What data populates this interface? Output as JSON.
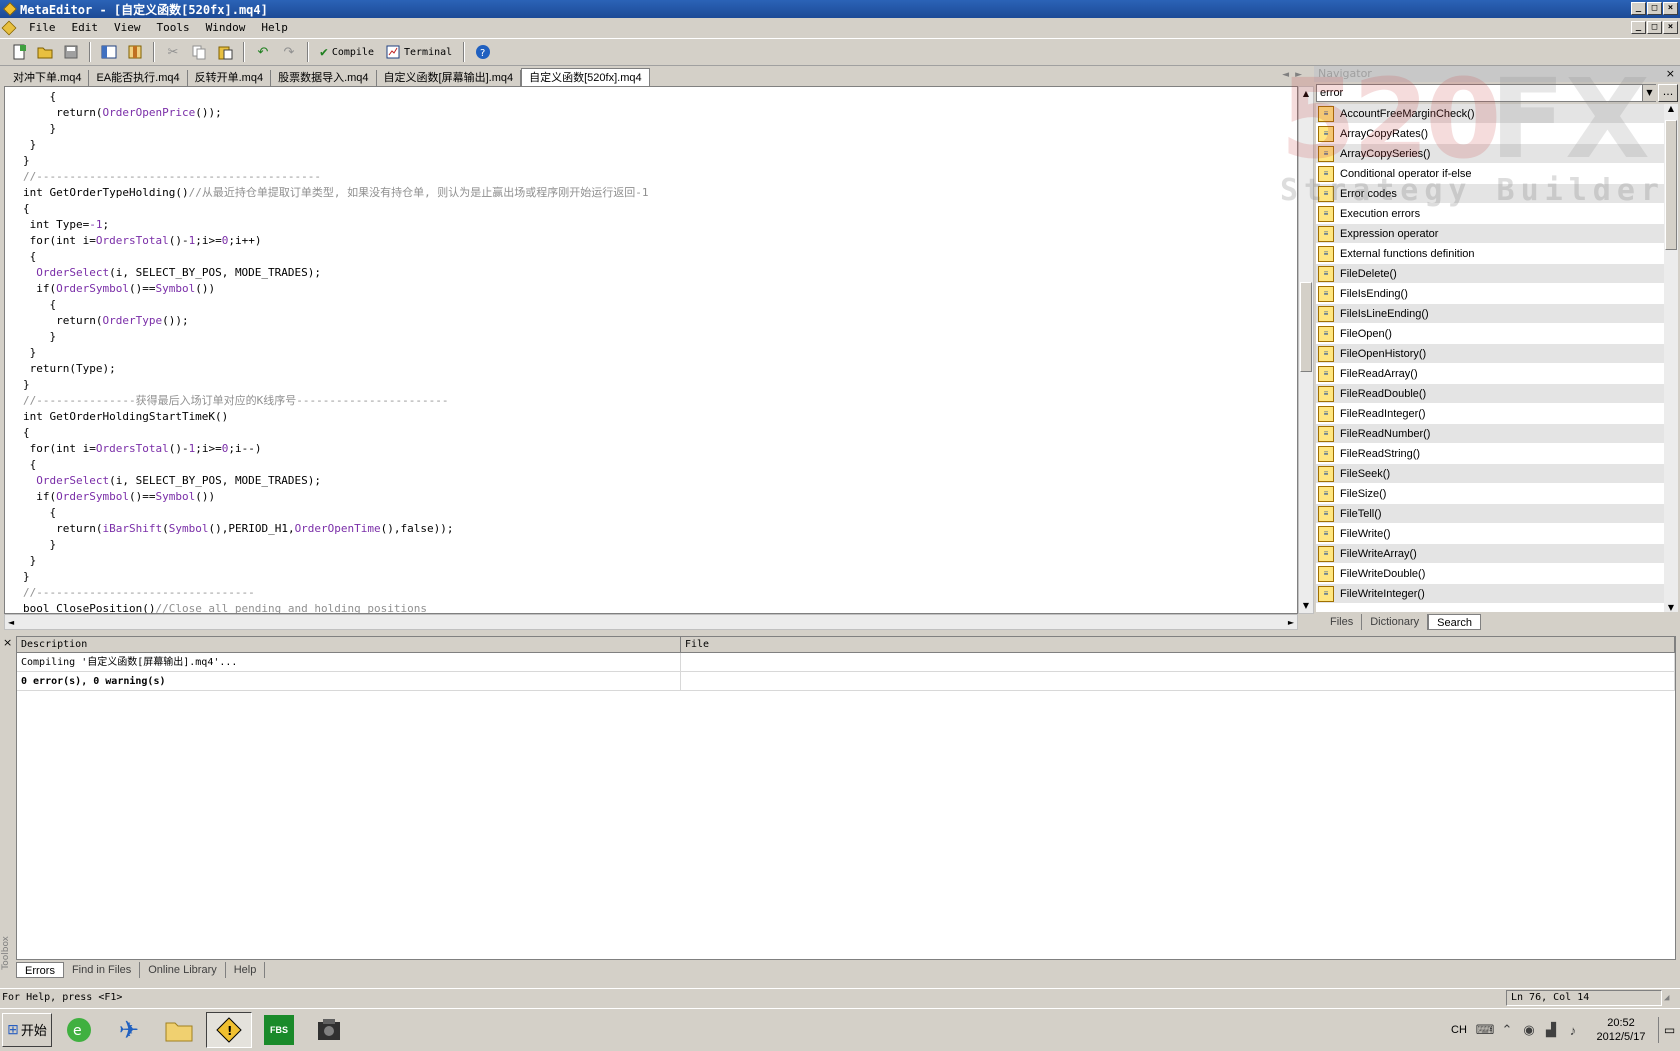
{
  "window": {
    "title": "MetaEditor - [自定义函数[520fx].mq4]",
    "min": "_",
    "max": "□",
    "close": "×"
  },
  "menu": {
    "items": [
      "File",
      "Edit",
      "View",
      "Tools",
      "Window",
      "Help"
    ]
  },
  "toolbar": {
    "compile_label": "Compile",
    "terminal_label": "Terminal"
  },
  "file_tabs": [
    {
      "label": "对冲下单.mq4",
      "active": false
    },
    {
      "label": "EA能否执行.mq4",
      "active": false
    },
    {
      "label": "反转开单.mq4",
      "active": false
    },
    {
      "label": "股票数据导入.mq4",
      "active": false
    },
    {
      "label": "自定义函数[屏幕输出].mq4",
      "active": false
    },
    {
      "label": "自定义函数[520fx].mq4",
      "active": true
    }
  ],
  "code_lines": [
    "    {",
    "     return(OrderOpenPrice());",
    "    }",
    " }",
    "}",
    "//-------------------------------------------",
    "int GetOrderTypeHolding()//从最近持仓单提取订单类型, 如果没有持仓单, 则认为是止赢出场或程序刚开始运行返回-1",
    "{",
    " int Type=-1;",
    " for(int i=OrdersTotal()-1;i>=0;i++)",
    " {",
    "  OrderSelect(i, SELECT_BY_POS, MODE_TRADES);",
    "  if(OrderSymbol()==Symbol())",
    "    {",
    "     return(OrderType());",
    "    }",
    " }",
    " return(Type);",
    "}",
    "//---------------获得最后入场订单对应的K线序号-----------------------",
    "int GetOrderHoldingStartTimeK()",
    "{",
    " for(int i=OrdersTotal()-1;i>=0;i--)",
    " {",
    "  OrderSelect(i, SELECT_BY_POS, MODE_TRADES);",
    "  if(OrderSymbol()==Symbol())",
    "    {",
    "     return(iBarShift(Symbol(),PERIOD_H1,OrderOpenTime(),false));",
    "    }",
    " }",
    "}",
    "//---------------------------------",
    "bool ClosePosition()//Close all pending and holding positions"
  ],
  "navigator": {
    "title": "Navigator",
    "close": "×",
    "search_value": "error",
    "more_label": "...",
    "items": [
      "AccountFreeMarginCheck()",
      "ArrayCopyRates()",
      "ArrayCopySeries()",
      "Conditional operator if-else",
      "Error codes",
      "Execution errors",
      "Expression operator",
      "External functions definition",
      "FileDelete()",
      "FileIsEnding()",
      "FileIsLineEnding()",
      "FileOpen()",
      "FileOpenHistory()",
      "FileReadArray()",
      "FileReadDouble()",
      "FileReadInteger()",
      "FileReadNumber()",
      "FileReadString()",
      "FileSeek()",
      "FileSize()",
      "FileTell()",
      "FileWrite()",
      "FileWriteArray()",
      "FileWriteDouble()",
      "FileWriteInteger()"
    ],
    "tabs": [
      {
        "label": "Files",
        "active": false
      },
      {
        "label": "Dictionary",
        "active": false
      },
      {
        "label": "Search",
        "active": true
      }
    ]
  },
  "watermark": {
    "big": "520",
    "big2": "FX",
    "small": "Strategy Builder"
  },
  "output": {
    "columns": [
      "Description",
      "File"
    ],
    "rows": [
      {
        "description": "Compiling '自定义函数[屏幕输出].mq4'...",
        "file": "",
        "bold": false
      },
      {
        "description": "0 error(s), 0 warning(s)",
        "file": "",
        "bold": true
      }
    ]
  },
  "toolbox": {
    "label": "Toolbox",
    "close": "×",
    "tabs": [
      {
        "label": "Errors",
        "active": true
      },
      {
        "label": "Find in Files",
        "active": false
      },
      {
        "label": "Online Library",
        "active": false
      },
      {
        "label": "Help",
        "active": false
      }
    ]
  },
  "statusbar": {
    "help": "For Help, press <F1>",
    "position": "Ln 76, Col 14"
  },
  "taskbar": {
    "start_label": "开始",
    "fbs_label": "FBS",
    "lang": "CH",
    "time": "20:52",
    "date": "2012/5/17"
  }
}
